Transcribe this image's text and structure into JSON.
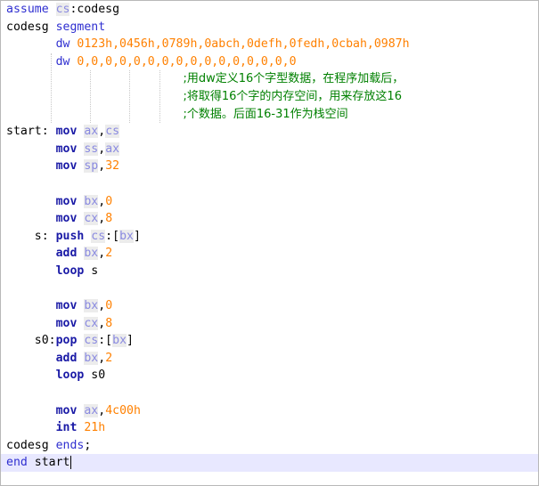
{
  "editor": {
    "lines": [
      [
        {
          "t": "assume ",
          "c": "kw"
        },
        {
          "t": "cs",
          "c": "reg"
        },
        {
          "t": ":codesg",
          "c": "plain"
        }
      ],
      [
        {
          "t": "codesg ",
          "c": "plain"
        },
        {
          "t": "segment",
          "c": "kw"
        }
      ],
      [
        {
          "t": "       ",
          "c": "plain"
        },
        {
          "t": "dw ",
          "c": "kw"
        },
        {
          "t": "0123h,0456h,0789h,0abch,0defh,0fedh,0cbah,0987h",
          "c": "num"
        }
      ],
      [
        {
          "t": "       ",
          "c": "plain"
        },
        {
          "t": "dw ",
          "c": "kw"
        },
        {
          "t": "0,0,0,0,0,0,0,0,0,0,0,0,0,0,0,0",
          "c": "num"
        }
      ],
      [
        {
          "t": "                         ",
          "c": "plain"
        },
        {
          "t": ";用dw定义16个字型数据，在程序加载后，",
          "c": "cmt"
        }
      ],
      [
        {
          "t": "                         ",
          "c": "plain"
        },
        {
          "t": ";将取得16个字的内存空间，用来存放这16",
          "c": "cmt"
        }
      ],
      [
        {
          "t": "                         ",
          "c": "plain"
        },
        {
          "t": ";个数据。后面16-31作为栈空间",
          "c": "cmt"
        }
      ],
      [
        {
          "t": "start: ",
          "c": "plain"
        },
        {
          "t": "mov ",
          "c": "ins"
        },
        {
          "t": "ax",
          "c": "reg"
        },
        {
          "t": ",",
          "c": "plain"
        },
        {
          "t": "cs",
          "c": "reg"
        }
      ],
      [
        {
          "t": "       ",
          "c": "plain"
        },
        {
          "t": "mov ",
          "c": "ins"
        },
        {
          "t": "ss",
          "c": "reg"
        },
        {
          "t": ",",
          "c": "plain"
        },
        {
          "t": "ax",
          "c": "reg"
        }
      ],
      [
        {
          "t": "       ",
          "c": "plain"
        },
        {
          "t": "mov ",
          "c": "ins"
        },
        {
          "t": "sp",
          "c": "reg"
        },
        {
          "t": ",",
          "c": "plain"
        },
        {
          "t": "32",
          "c": "num"
        }
      ],
      [],
      [
        {
          "t": "       ",
          "c": "plain"
        },
        {
          "t": "mov ",
          "c": "ins"
        },
        {
          "t": "bx",
          "c": "reg"
        },
        {
          "t": ",",
          "c": "plain"
        },
        {
          "t": "0",
          "c": "num"
        }
      ],
      [
        {
          "t": "       ",
          "c": "plain"
        },
        {
          "t": "mov ",
          "c": "ins"
        },
        {
          "t": "cx",
          "c": "reg"
        },
        {
          "t": ",",
          "c": "plain"
        },
        {
          "t": "8",
          "c": "num"
        }
      ],
      [
        {
          "t": "    s: ",
          "c": "plain"
        },
        {
          "t": "push ",
          "c": "ins"
        },
        {
          "t": "cs",
          "c": "reg"
        },
        {
          "t": ":[",
          "c": "plain"
        },
        {
          "t": "bx",
          "c": "reg"
        },
        {
          "t": "]",
          "c": "plain"
        }
      ],
      [
        {
          "t": "       ",
          "c": "plain"
        },
        {
          "t": "add ",
          "c": "ins"
        },
        {
          "t": "bx",
          "c": "reg"
        },
        {
          "t": ",",
          "c": "plain"
        },
        {
          "t": "2",
          "c": "num"
        }
      ],
      [
        {
          "t": "       ",
          "c": "plain"
        },
        {
          "t": "loop ",
          "c": "ins"
        },
        {
          "t": "s",
          "c": "plain"
        }
      ],
      [],
      [
        {
          "t": "       ",
          "c": "plain"
        },
        {
          "t": "mov ",
          "c": "ins"
        },
        {
          "t": "bx",
          "c": "reg"
        },
        {
          "t": ",",
          "c": "plain"
        },
        {
          "t": "0",
          "c": "num"
        }
      ],
      [
        {
          "t": "       ",
          "c": "plain"
        },
        {
          "t": "mov ",
          "c": "ins"
        },
        {
          "t": "cx",
          "c": "reg"
        },
        {
          "t": ",",
          "c": "plain"
        },
        {
          "t": "8",
          "c": "num"
        }
      ],
      [
        {
          "t": "    s0:",
          "c": "plain"
        },
        {
          "t": "pop ",
          "c": "ins"
        },
        {
          "t": "cs",
          "c": "reg"
        },
        {
          "t": ":[",
          "c": "plain"
        },
        {
          "t": "bx",
          "c": "reg"
        },
        {
          "t": "]",
          "c": "plain"
        }
      ],
      [
        {
          "t": "       ",
          "c": "plain"
        },
        {
          "t": "add ",
          "c": "ins"
        },
        {
          "t": "bx",
          "c": "reg"
        },
        {
          "t": ",",
          "c": "plain"
        },
        {
          "t": "2",
          "c": "num"
        }
      ],
      [
        {
          "t": "       ",
          "c": "plain"
        },
        {
          "t": "loop ",
          "c": "ins"
        },
        {
          "t": "s0",
          "c": "plain"
        }
      ],
      [],
      [
        {
          "t": "       ",
          "c": "plain"
        },
        {
          "t": "mov ",
          "c": "ins"
        },
        {
          "t": "ax",
          "c": "reg"
        },
        {
          "t": ",",
          "c": "plain"
        },
        {
          "t": "4c00h",
          "c": "num"
        }
      ],
      [
        {
          "t": "       ",
          "c": "plain"
        },
        {
          "t": "int ",
          "c": "ins"
        },
        {
          "t": "21h",
          "c": "num"
        }
      ],
      [
        {
          "t": "codesg ",
          "c": "plain"
        },
        {
          "t": "ends",
          "c": "kw"
        },
        {
          "t": ";",
          "c": "plain"
        }
      ],
      [
        {
          "t": "end ",
          "c": "kw"
        },
        {
          "t": "start",
          "c": "plain"
        }
      ]
    ],
    "current_line": 26,
    "colors": {
      "keyword": "#2f2fd0",
      "instruction": "#1a1aa6",
      "register": "#8a8ae0",
      "number": "#ff8000",
      "comment": "#008000",
      "current_line_bg": "#e8e8ff"
    }
  }
}
